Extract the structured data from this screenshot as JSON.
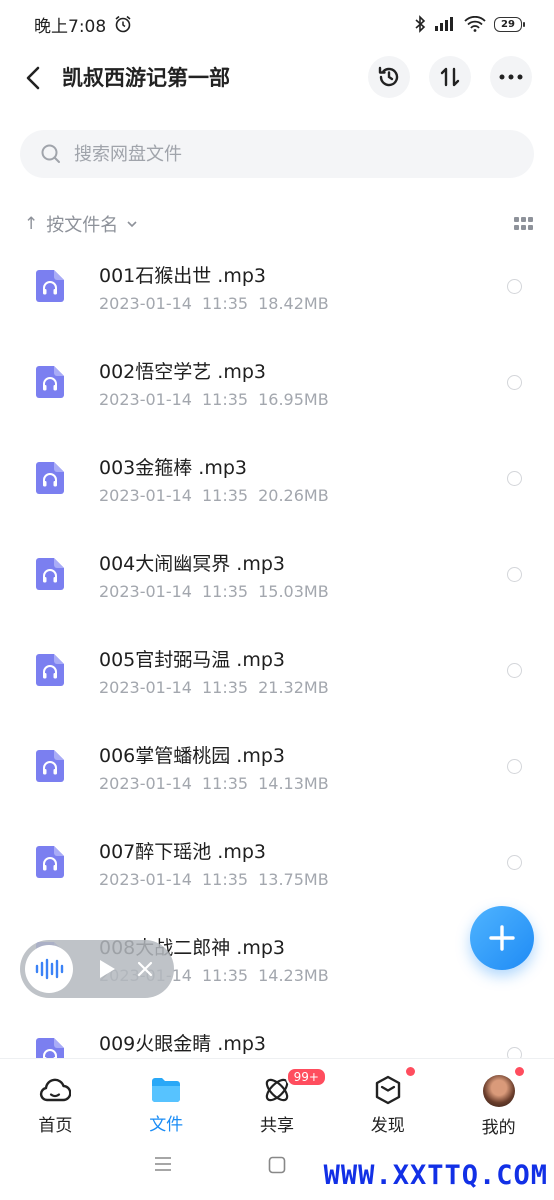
{
  "status_bar": {
    "time": "晚上7:08",
    "battery": "29"
  },
  "header": {
    "title": "凯叔西游记第一部"
  },
  "search": {
    "placeholder": "搜索网盘文件"
  },
  "sort": {
    "label": "按文件名"
  },
  "files": [
    {
      "name": "001石猴出世 .mp3",
      "date": "2023-01-14",
      "time": "11:35",
      "size": "18.42MB"
    },
    {
      "name": "002悟空学艺 .mp3",
      "date": "2023-01-14",
      "time": "11:35",
      "size": "16.95MB"
    },
    {
      "name": "003金箍棒 .mp3",
      "date": "2023-01-14",
      "time": "11:35",
      "size": "20.26MB"
    },
    {
      "name": "004大闹幽冥界 .mp3",
      "date": "2023-01-14",
      "time": "11:35",
      "size": "15.03MB"
    },
    {
      "name": "005官封弼马温 .mp3",
      "date": "2023-01-14",
      "time": "11:35",
      "size": "21.32MB"
    },
    {
      "name": "006掌管蟠桃园 .mp3",
      "date": "2023-01-14",
      "time": "11:35",
      "size": "14.13MB"
    },
    {
      "name": "007醉下瑶池 .mp3",
      "date": "2023-01-14",
      "time": "11:35",
      "size": "13.75MB"
    },
    {
      "name": "008大战二郎神 .mp3",
      "date": "2023-01-14",
      "time": "11:35",
      "size": "14.23MB"
    },
    {
      "name": "009火眼金睛 .mp3",
      "date": "",
      "time": "",
      "size": ""
    }
  ],
  "tabs": [
    {
      "label": "首页",
      "icon": "cloud-home-icon"
    },
    {
      "label": "文件",
      "icon": "folder-icon",
      "active": true
    },
    {
      "label": "共享",
      "icon": "share-atom-icon",
      "badge": "99+"
    },
    {
      "label": "发现",
      "icon": "cube-icon",
      "dot": true
    },
    {
      "label": "我的",
      "icon": "avatar",
      "dot": true
    }
  ],
  "watermark": "WWW.XXTTQ.COM",
  "colors": {
    "accent": "#1a8cf5",
    "file_icon": "#7b7ff0",
    "badge": "#ff4d5e"
  }
}
